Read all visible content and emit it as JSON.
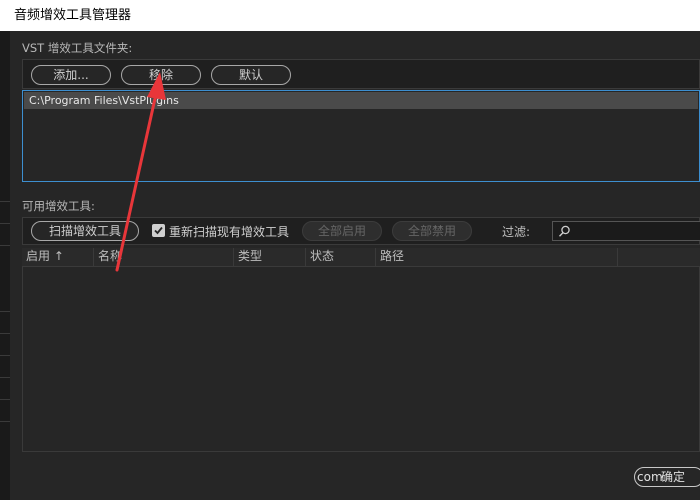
{
  "window": {
    "title": "音频增效工具管理器"
  },
  "vst_folder": {
    "label": "VST 增效工具文件夹:",
    "buttons": {
      "add": "添加...",
      "remove": "移除",
      "default": "默认"
    },
    "paths": [
      "C:\\Program Files\\VstPlugins"
    ]
  },
  "available": {
    "label": "可用增效工具:",
    "scan_button": "扫描增效工具",
    "rescan_checkbox": {
      "label": "重新扫描现有增效工具",
      "checked": true
    },
    "enable_all": "全部启用",
    "disable_all": "全部禁用",
    "filter_label": "过滤:",
    "search": {
      "value": "",
      "placeholder": ""
    },
    "columns": [
      "启用",
      "名称",
      "类型",
      "状态",
      "路径"
    ],
    "sort_indicator": "↑"
  },
  "footer": {
    "ok": "确定",
    "ok_overlap": "com"
  },
  "colors": {
    "accent_border": "#3d8fd0",
    "annotation_arrow": "#e8363a"
  },
  "icons": {
    "search": "search-icon",
    "check": "checkmark-icon",
    "sort": "sort-ascending-icon"
  }
}
